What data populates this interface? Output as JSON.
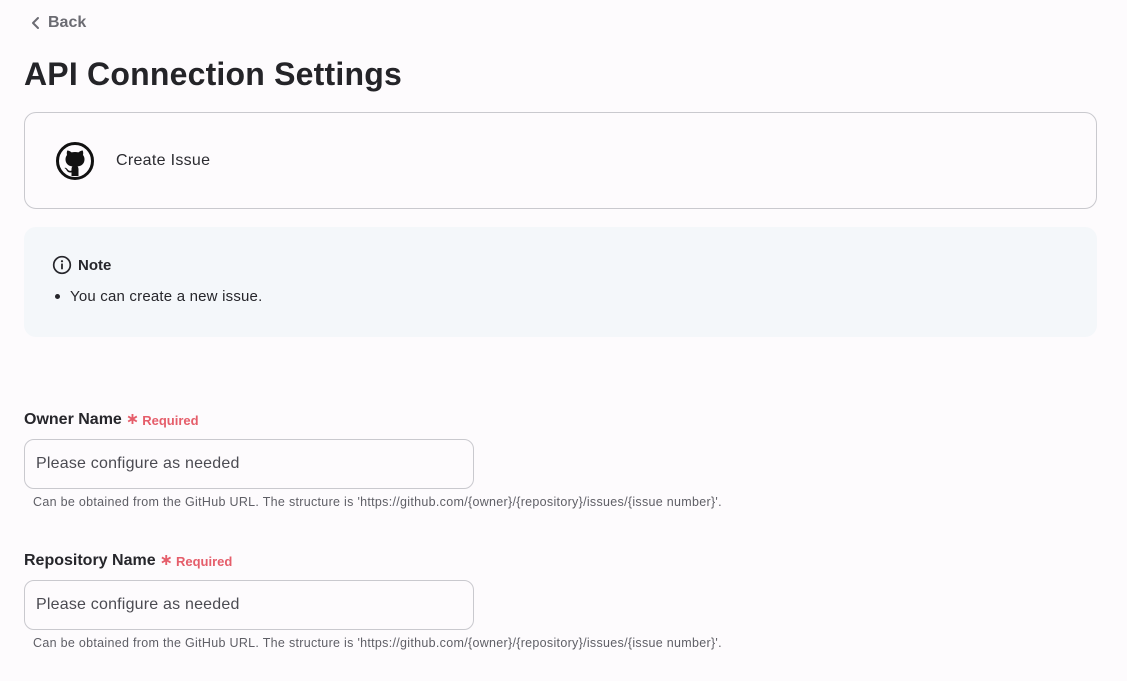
{
  "nav": {
    "back_label": "Back"
  },
  "page": {
    "title": "API Connection Settings"
  },
  "action": {
    "name": "Create Issue",
    "icon": "github-icon"
  },
  "note": {
    "title": "Note",
    "icon": "info-icon",
    "items": [
      "You can create a new issue."
    ]
  },
  "fields": [
    {
      "label": "Owner Name",
      "required_label": "Required",
      "placeholder": "Please configure as needed",
      "value": "",
      "hint": "Can be obtained from the GitHub URL. The structure is 'https://github.com/{owner}/{repository}/issues/{issue number}'."
    },
    {
      "label": "Repository Name",
      "required_label": "Required",
      "placeholder": "Please configure as needed",
      "value": "",
      "hint": "Can be obtained from the GitHub URL. The structure is 'https://github.com/{owner}/{repository}/issues/{issue number}'."
    }
  ],
  "colors": {
    "required": "#e55d6a",
    "note_background": "#f4f7fa",
    "border": "#c9c9ce"
  }
}
